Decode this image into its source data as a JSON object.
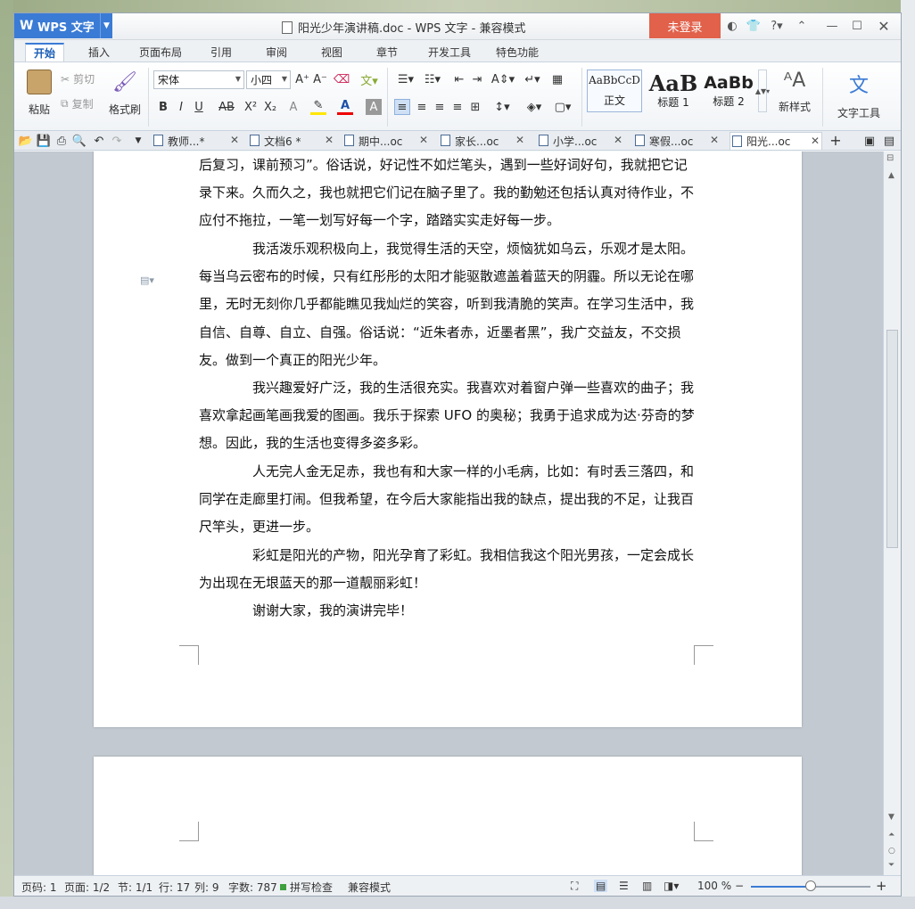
{
  "window": {
    "app_name": "WPS 文字",
    "title": "阳光少年演讲稿.doc - WPS 文字 - 兼容模式",
    "login_label": "未登录"
  },
  "ribbon_tabs": [
    "开始",
    "插入",
    "页面布局",
    "引用",
    "审阅",
    "视图",
    "章节",
    "开发工具",
    "特色功能"
  ],
  "ribbon": {
    "paste": "粘贴",
    "cut": "剪切",
    "copy": "复制",
    "format_painter": "格式刷",
    "font_name": "宋体",
    "font_size": "小四",
    "styles": [
      {
        "preview": "AaBbCcD",
        "label": "正文"
      },
      {
        "preview": "AaB",
        "label": "标题 1"
      },
      {
        "preview": "AaBb",
        "label": "标题 2"
      }
    ],
    "new_style": "新样式",
    "text_tools": "文字工具"
  },
  "doc_tabs": [
    {
      "label": "教师...*"
    },
    {
      "label": "文档6 *"
    },
    {
      "label": "期中...oc"
    },
    {
      "label": "家长...oc"
    },
    {
      "label": "小学...oc"
    },
    {
      "label": "寒假...oc"
    },
    {
      "label": "阳光...oc"
    }
  ],
  "document": {
    "paragraphs": [
      "后复习，课前预习”。俗话说，好记性不如烂笔头，遇到一些好词好句，我就把它记录下来。久而久之，我也就把它们记在脑子里了。我的勤勉还包括认真对待作业，不应付不拖拉，一笔一划写好每一个字，踏踏实实走好每一步。",
      "我活泼乐观积极向上，我觉得生活的天空，烦恼犹如乌云，乐观才是太阳。每当乌云密布的时候，只有红彤彤的太阳才能驱散遮盖着蓝天的阴霾。所以无论在哪里，无时无刻你几乎都能瞧见我灿烂的笑容，听到我清脆的笑声。在学习生活中，我自信、自尊、自立、自强。俗话说：“近朱者赤，近墨者黑”，我广交益友，不交损友。做到一个真正的阳光少年。",
      "我兴趣爱好广泛，我的生活很充实。我喜欢对着窗户弹一些喜欢的曲子；我喜欢拿起画笔画我爱的图画。我乐于探索 UFO 的奥秘；我勇于追求成为达·芬奇的梦想。因此，我的生活也变得多姿多彩。",
      "人无完人金无足赤，我也有和大家一样的小毛病，比如：有时丢三落四，和同学在走廊里打闹。但我希望，在今后大家能指出我的缺点，提出我的不足，让我百尺竿头，更进一步。",
      "彩虹是阳光的产物，阳光孕育了彩虹。我相信我这个阳光男孩，一定会成长为出现在无垠蓝天的那一道靓丽彩虹！",
      "谢谢大家，我的演讲完毕！"
    ]
  },
  "status": {
    "page_code": "页码: 1",
    "pages": "页面: 1/2",
    "section": "节: 1/1",
    "line": "行: 17",
    "column": "列: 9",
    "word_count": "字数: 787",
    "spell_check": "拼写检查",
    "compat_mode": "兼容模式",
    "zoom": "100 %"
  }
}
